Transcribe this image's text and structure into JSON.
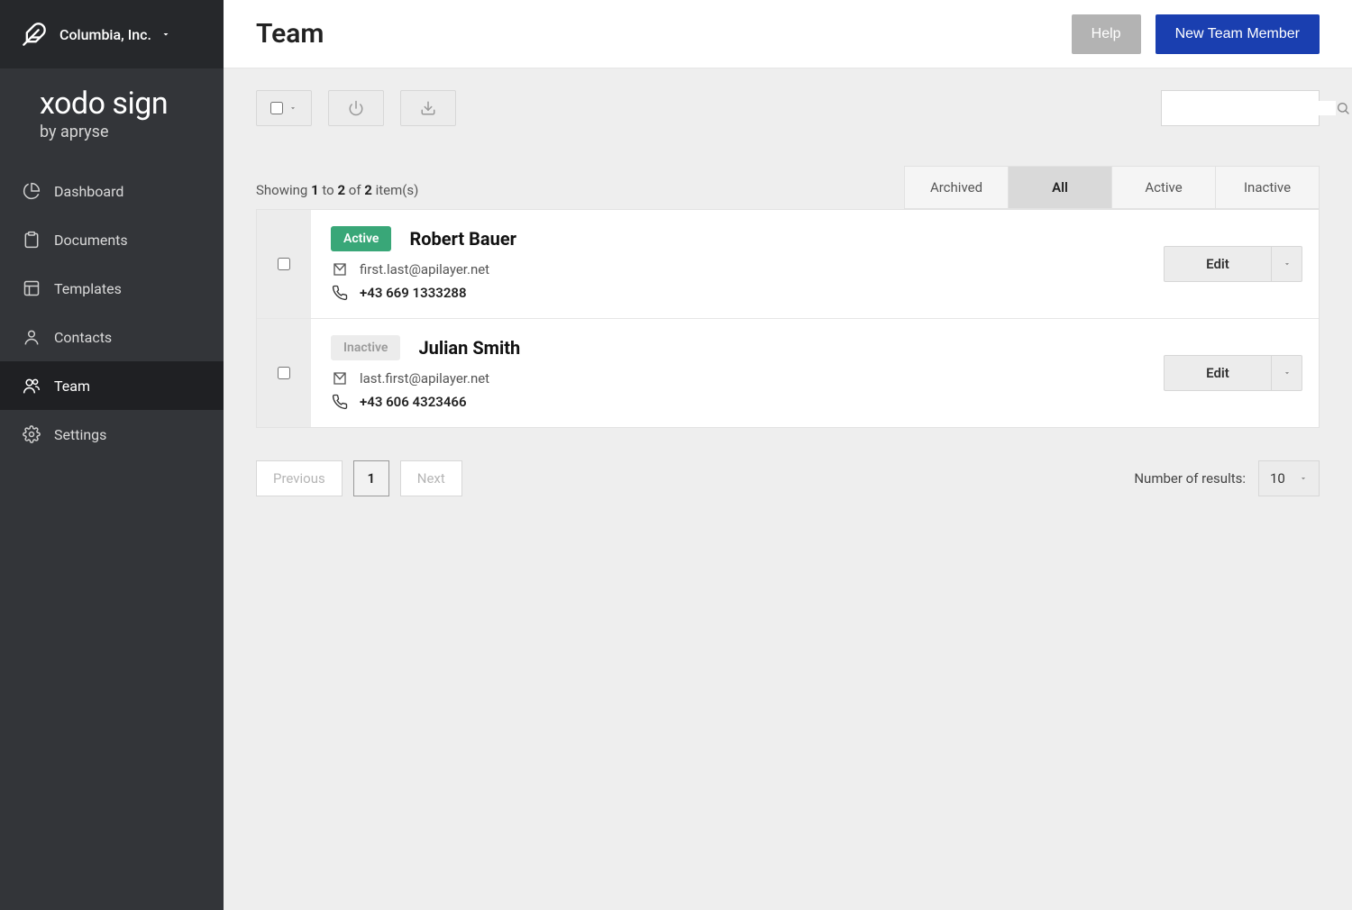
{
  "org": {
    "name": "Columbia, Inc."
  },
  "product": {
    "name": "xodo sign",
    "byline": "by apryse"
  },
  "sidebar": {
    "items": [
      {
        "label": "Dashboard"
      },
      {
        "label": "Documents"
      },
      {
        "label": "Templates"
      },
      {
        "label": "Contacts"
      },
      {
        "label": "Team"
      },
      {
        "label": "Settings"
      }
    ]
  },
  "header": {
    "title": "Team",
    "help_label": "Help",
    "new_member_label": "New Team Member"
  },
  "showing": {
    "prefix": "Showing ",
    "from": "1",
    "mid1": " to ",
    "to": "2",
    "mid2": " of ",
    "total": "2",
    "suffix": " item(s)"
  },
  "tabs": [
    {
      "label": "Archived"
    },
    {
      "label": "All"
    },
    {
      "label": "Active"
    },
    {
      "label": "Inactive"
    }
  ],
  "members": [
    {
      "status": "Active",
      "name": "Robert Bauer",
      "email": "first.last@apilayer.net",
      "phone": "+43 669 1333288",
      "edit_label": "Edit"
    },
    {
      "status": "Inactive",
      "name": "Julian Smith",
      "email": "last.first@apilayer.net",
      "phone": "+43 606 4323466",
      "edit_label": "Edit"
    }
  ],
  "pagination": {
    "prev": "Previous",
    "page": "1",
    "next": "Next",
    "results_label": "Number of results:",
    "per_page": "10"
  }
}
